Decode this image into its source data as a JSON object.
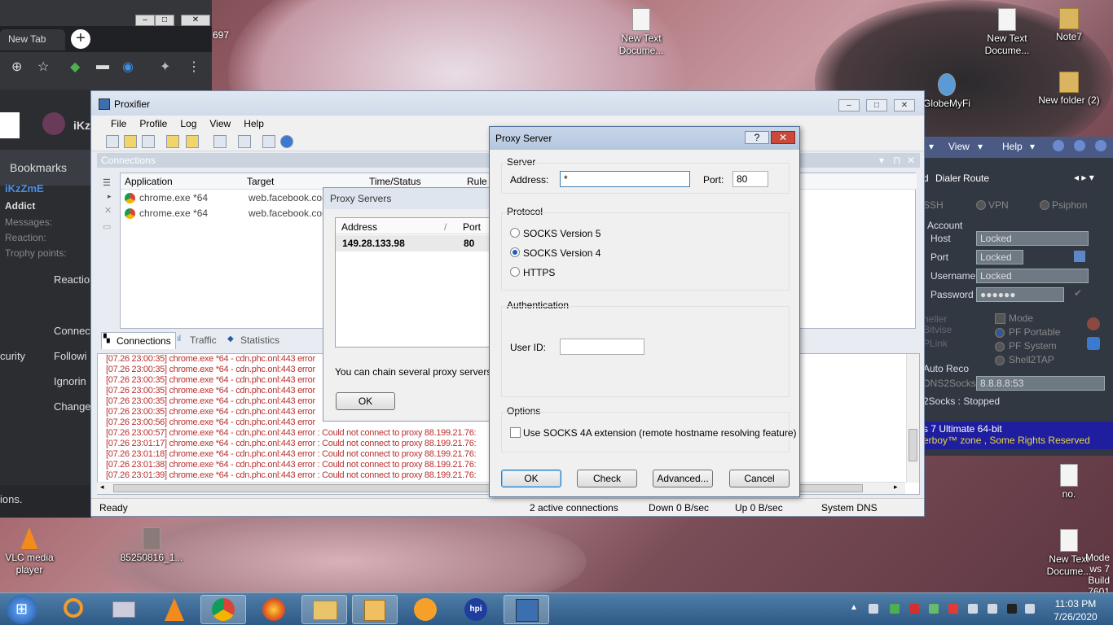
{
  "desktop": {
    "icons": [
      {
        "name": "New Text Docume...",
        "id": "desktop-icon-new-text-1"
      },
      {
        "name": "New Text Docume...",
        "id": "desktop-icon-new-text-2"
      },
      {
        "name": "Note7",
        "id": "desktop-icon-note7"
      },
      {
        "name": "GlobeMyFi",
        "id": "desktop-icon-globemyfi"
      },
      {
        "name": "New folder (2)",
        "id": "desktop-icon-new-folder"
      },
      {
        "name": "no.",
        "id": "desktop-icon-no"
      },
      {
        "name": "New Text Docume...",
        "id": "desktop-icon-new-text-3"
      },
      {
        "name": "VLC media player",
        "id": "desktop-icon-vlc"
      },
      {
        "name": "85250816_1...",
        "id": "desktop-icon-image"
      }
    ],
    "num_697": "697",
    "watermark": {
      "line1": "Mode",
      "line2": "ws 7",
      "line3": "Build 7601"
    }
  },
  "chrome": {
    "tab_label": "New Tab",
    "new_tab": "+"
  },
  "facebook": {
    "user": "iKz",
    "bookmarks": "Bookmarks",
    "name": "iKzZmE",
    "rank": "Addict",
    "messages": "Messages:",
    "reaction": "Reaction:",
    "trophy": "Trophy points:",
    "reactio": "Reactio",
    "connec": "Connec",
    "curity": "curity",
    "followi": "Followi",
    "ignorin": "Ignorin",
    "change": "Change",
    "ions": "ions."
  },
  "proxifier": {
    "title": "Proxifier",
    "menu": [
      "File",
      "Profile",
      "Log",
      "View",
      "Help"
    ],
    "connections_header": "Connections",
    "columns": [
      "Application",
      "Target",
      "Time/Status",
      "Rule"
    ],
    "rows": [
      {
        "app": "chrome.exe *64",
        "target": "web.facebook.com"
      },
      {
        "app": "chrome.exe *64",
        "target": "web.facebook.com"
      }
    ],
    "tabs": [
      "Connections",
      "Traffic",
      "Statistics"
    ],
    "log": [
      "[07.26 23:00:35] chrome.exe *64 - cdn.phc.onl:443 error",
      "[07.26 23:00:35] chrome.exe *64 - cdn.phc.onl:443 error",
      "[07.26 23:00:35] chrome.exe *64 - cdn.phc.onl:443 error",
      "[07.26 23:00:35] chrome.exe *64 - cdn.phc.onl:443 error",
      "[07.26 23:00:35] chrome.exe *64 - cdn.phc.onl:443 error",
      "[07.26 23:00:35] chrome.exe *64 - cdn.phc.onl:443 error",
      "[07.26 23:00:56] chrome.exe *64 - cdn.phc.onl:443 error",
      "[07.26 23:00:57] chrome.exe *64 - cdn.phc.onl:443 error : Could not connect to proxy 88.199.21.76:",
      "[07.26 23:01:17] chrome.exe *64 - cdn.phc.onl:443 error : Could not connect to proxy 88.199.21.76:",
      "[07.26 23:01:18] chrome.exe *64 - cdn.phc.onl:443 error : Could not connect to proxy 88.199.21.76:",
      "[07.26 23:01:38] chrome.exe *64 - cdn.phc.onl:443 error : Could not connect to proxy 88.199.21.76:",
      "[07.26 23:01:39] chrome.exe *64 - cdn.phc.onl:443 error : Could not connect to proxy 88.199.21.76:"
    ],
    "status": {
      "ready": "Ready",
      "active": "2 active connections",
      "down": "Down 0 B/sec",
      "up": "Up 0 B/sec",
      "dns": "System DNS"
    }
  },
  "proxy_servers": {
    "title": "Proxy Servers",
    "col_address": "Address",
    "col_sep": "/",
    "col_port": "Port",
    "address": "149.28.133.98",
    "port": "80",
    "chain_text": "You can chain several proxy servers tog",
    "ok": "OK"
  },
  "proxy_server": {
    "title": "Proxy Server",
    "help": "?",
    "server_group": "Server",
    "address_label": "Address:",
    "address_value": "*",
    "port_label": "Port:",
    "port_value": "80",
    "protocol_group": "Protocol",
    "protocols": [
      "SOCKS Version 5",
      "SOCKS Version 4",
      "HTTPS"
    ],
    "selected_protocol": "SOCKS Version 4",
    "auth_group": "Authentication",
    "userid_label": "User ID:",
    "userid_value": "",
    "options_group": "Options",
    "socks4a": "Use SOCKS 4A extension (remote hostname resolving feature)",
    "buttons": {
      "ok": "OK",
      "check": "Check",
      "advanced": "Advanced...",
      "cancel": "Cancel"
    }
  },
  "right_app": {
    "menu": [
      "View",
      "Help"
    ],
    "tabs": [
      "d",
      "Dialer",
      "Route"
    ],
    "radios": [
      "SSH",
      "VPN",
      "Psiphon"
    ],
    "account": "Account",
    "host": "Host",
    "host_val": "Locked",
    "port": "Port",
    "port_val": "Locked",
    "username": "Username",
    "username_val": "Locked",
    "password": "Password",
    "password_val": "●●●●●●",
    "heller": "heller",
    "bitvise": "Bitvise",
    "plink": "PLink",
    "mode": "Mode",
    "pf_portable": "PF Portable",
    "pf_system": "PF System",
    "shell2tap": "Shell2TAP",
    "auto_reco": "Auto Reco",
    "dns2socks": "DNS2Socks",
    "dns_val": "8.8.8.8:53",
    "socks_status": "2Socks : Stopped",
    "footer1": "s 7 Ultimate  64-bit",
    "footer2": "erboy™ zone , Some Rights Reserved"
  },
  "taskbar": {
    "time": "11:03 PM",
    "date": "7/26/2020"
  },
  "colors": {
    "accent": "#1d5ac4",
    "log_error": "#b8312f",
    "taskbar": "#3a6a96"
  }
}
